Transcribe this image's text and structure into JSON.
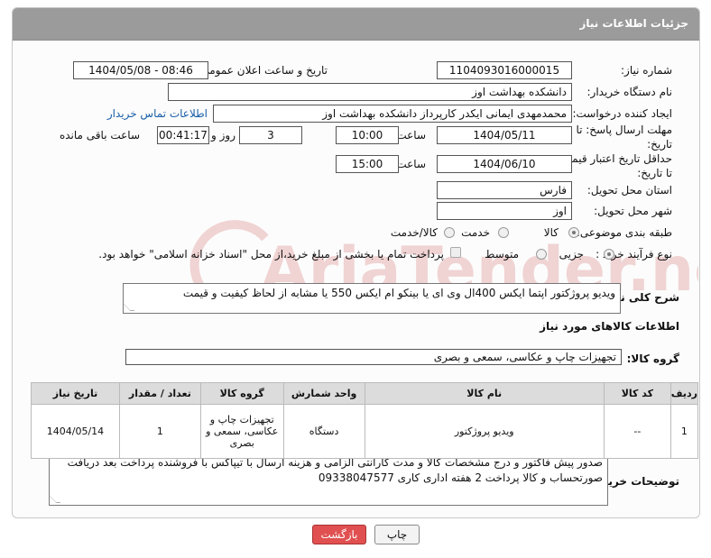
{
  "header": {
    "title": "جزئیات اطلاعات نیاز"
  },
  "fields": {
    "need_number": {
      "label": "شماره نیاز:",
      "value": "1104093016000015"
    },
    "announce_datetime": {
      "label": "تاریخ و ساعت اعلان عمومی:",
      "value": "1404/05/08 - 08:46"
    },
    "buyer_org": {
      "label": "نام دستگاه خریدار:",
      "value": "دانشکده بهداشت اوز"
    },
    "requester": {
      "label": "ایجاد کننده درخواست:",
      "value": "محمدمهدی ایمانی ایکدر کارپرداز دانشکده بهداشت اوز",
      "contact_link": "اطلاعات تماس خریدار"
    },
    "reply_deadline": {
      "label1": "مهلت ارسال پاسخ: تا",
      "label2": "تاریخ:",
      "date": "1404/05/11",
      "time_label": "ساعت",
      "time": "10:00",
      "days": "3",
      "days_label": "روز و",
      "remaining": "00:41:17",
      "remaining_label": "ساعت باقی مانده"
    },
    "price_validity": {
      "label1": "حداقل تاریخ اعتبار قیمت:",
      "label2": "تا تاریخ:",
      "date": "1404/06/10",
      "time_label": "ساعت",
      "time": "15:00"
    },
    "province": {
      "label": "استان محل تحویل:",
      "value": "فارس"
    },
    "city": {
      "label": "شهر محل تحویل:",
      "value": "اوز"
    },
    "category": {
      "label": "طبقه بندی موضوعی:",
      "options": [
        "کالا",
        "خدمت",
        "کالا/خدمت"
      ],
      "selected": "کالا"
    },
    "purchase_process": {
      "label": "نوع فرآیند خرید :",
      "options": [
        "جزیی",
        "متوسط"
      ],
      "selected": "جزیی",
      "payment_note": "پرداخت تمام یا بخشی از مبلغ خرید،از محل \"اسناد خزانه اسلامی\" خواهد بود."
    }
  },
  "description": {
    "label": "شرح کلی نیاز:",
    "value": "ویدیو پروژکتور اپتما  ایکس 400ال وی ای یا بینکو ام ایکس 550 یا مشابه از لحاظ کیفیت و قیمت"
  },
  "goods_section": {
    "title": "اطلاعات کالاهای مورد نیاز",
    "group_label": "گروه کالا:",
    "group_value": "تجهیزات چاپ و عکاسی، سمعی و بصری"
  },
  "table": {
    "headers": [
      "ردیف",
      "کد کالا",
      "نام کالا",
      "واحد شمارش",
      "گروه کالا",
      "تعداد / مقدار",
      "تاریخ نیاز"
    ],
    "rows": [
      [
        "1",
        "--",
        "ویدیو پروژکتور",
        "دستگاه",
        "تجهیزات چاپ و عکاسی، سمعی و بصری",
        "1",
        "1404/05/14"
      ]
    ]
  },
  "buyer_notes": {
    "label": "توضیحات خریدار:",
    "value": "صدور پیش فاکتور و درج مشخصات کالا و مدت گارانتی الزامی و هزینه ارسال با تیپاکس با فروشنده  پرداخت بعد دریافت صورتحساب و کالا پرداخت 2 هفته اداری کاری 09338047577"
  },
  "buttons": {
    "print": "چاپ",
    "back": "بازگشت"
  },
  "watermark": {
    "text": "AriaTender.neT",
    "color": "#e7b3b3"
  }
}
